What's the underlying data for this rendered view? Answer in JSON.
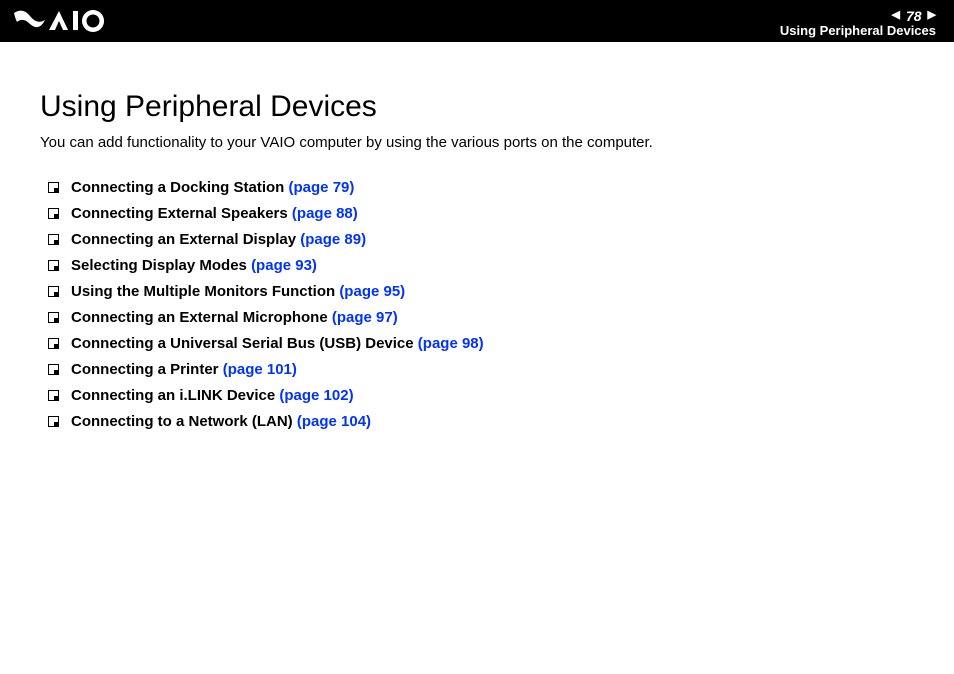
{
  "header": {
    "page_number": "78",
    "section_title": "Using Peripheral Devices",
    "logo_alt": "VAIO"
  },
  "main": {
    "heading": "Using Peripheral Devices",
    "intro": "You can add functionality to your VAIO computer by using the various ports on the computer.",
    "toc": [
      {
        "title": "Connecting a Docking Station",
        "page_ref": "(page 79)"
      },
      {
        "title": "Connecting External Speakers",
        "page_ref": "(page 88)"
      },
      {
        "title": "Connecting an External Display",
        "page_ref": "(page 89)"
      },
      {
        "title": "Selecting Display Modes",
        "page_ref": "(page 93)"
      },
      {
        "title": "Using the Multiple Monitors Function",
        "page_ref": "(page 95)"
      },
      {
        "title": "Connecting an External Microphone",
        "page_ref": "(page 97)"
      },
      {
        "title": "Connecting a Universal Serial Bus (USB) Device",
        "page_ref": "(page 98)"
      },
      {
        "title": "Connecting a Printer",
        "page_ref": "(page 101)"
      },
      {
        "title": "Connecting an i.LINK Device",
        "page_ref": "(page 102)"
      },
      {
        "title": "Connecting to a Network (LAN)",
        "page_ref": "(page 104)"
      }
    ]
  }
}
